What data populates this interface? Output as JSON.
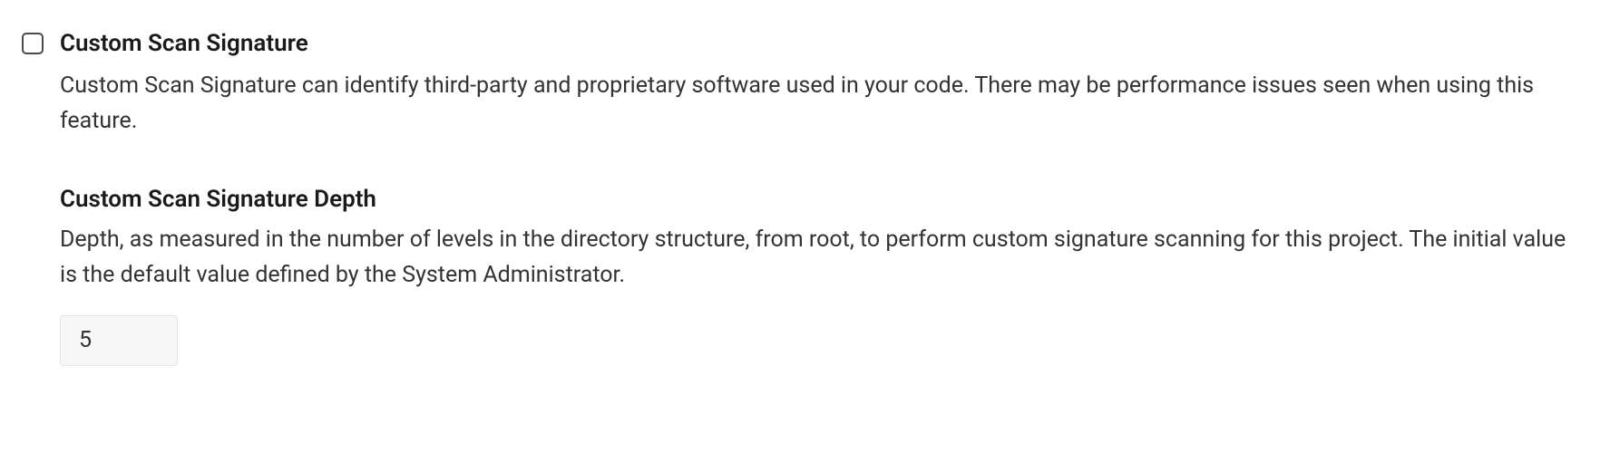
{
  "customScanSignature": {
    "label": "Custom Scan Signature",
    "description": "Custom Scan Signature can identify third-party and proprietary software used in your code. There may be performance issues seen when using this feature.",
    "checked": false
  },
  "customScanDepth": {
    "heading": "Custom Scan Signature Depth",
    "description": "Depth, as measured in the number of levels in the directory structure, from root, to perform custom signature scanning for this project. The initial value is the default value defined by the System Administrator.",
    "value": "5"
  }
}
